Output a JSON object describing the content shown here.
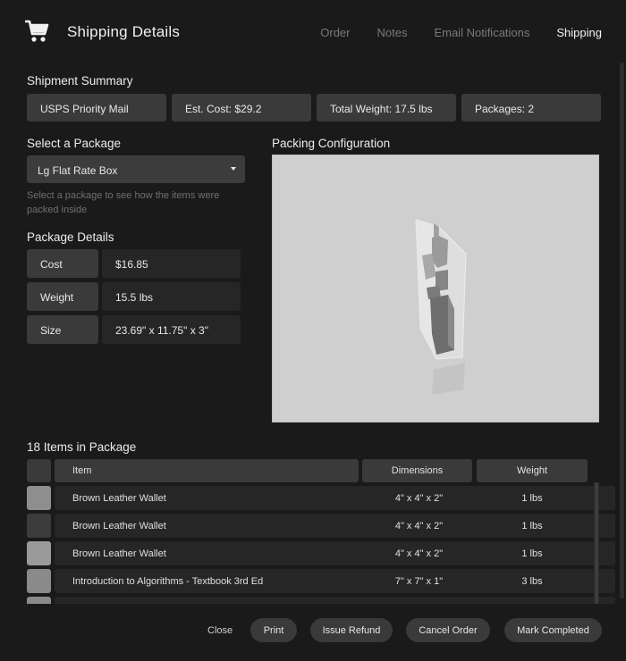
{
  "header": {
    "title": "Shipping Details",
    "icon": "shopping-cart-icon",
    "tabs": [
      {
        "label": "Order"
      },
      {
        "label": "Notes"
      },
      {
        "label": "Email Notifications"
      },
      {
        "label": "Shipping"
      }
    ],
    "active_tab": "Shipping"
  },
  "summary": {
    "title": "Shipment Summary",
    "carrier": "USPS Priority Mail",
    "est_cost": "Est. Cost: $29.2",
    "total_weight": "Total Weight: 17.5 lbs",
    "packages": "Packages: 2"
  },
  "package_select": {
    "title": "Select a Package",
    "selected": "Lg Flat Rate Box",
    "hint": "Select a package to see how the items were packed inside"
  },
  "package_details": {
    "title": "Package Details",
    "rows": [
      {
        "label": "Cost",
        "value": "$16.85"
      },
      {
        "label": "Weight",
        "value": "15.5 lbs"
      },
      {
        "label": "Size",
        "value": "23.69\" x 11.75\" x 3\""
      }
    ]
  },
  "packing": {
    "title": "Packing Configuration",
    "background": "#cfcfcf"
  },
  "items": {
    "title": "18 Items in Package",
    "columns": {
      "item": "Item",
      "dimensions": "Dimensions",
      "weight": "Weight"
    },
    "rows": [
      {
        "item": "Brown Leather Wallet",
        "dimensions": "4\" x 4\" x 2\"",
        "weight": "1 lbs",
        "swatch": "#8e8e8e"
      },
      {
        "item": "Brown Leather Wallet",
        "dimensions": "4\" x 4\" x 2\"",
        "weight": "1 lbs",
        "swatch": "#3c3c3c"
      },
      {
        "item": "Brown Leather Wallet",
        "dimensions": "4\" x 4\" x 2\"",
        "weight": "1 lbs",
        "swatch": "#9a9a9a"
      },
      {
        "item": "Introduction to Algorithms - Textbook 3rd Ed",
        "dimensions": "7\" x 7\" x 1\"",
        "weight": "3 lbs",
        "swatch": "#8a8a8a"
      },
      {
        "item": "",
        "dimensions": "",
        "weight": "",
        "swatch": "#8a8a8a"
      }
    ]
  },
  "footer": {
    "close": "Close",
    "print": "Print",
    "issue_refund": "Issue Refund",
    "cancel_order": "Cancel Order",
    "mark_completed": "Mark Completed"
  }
}
